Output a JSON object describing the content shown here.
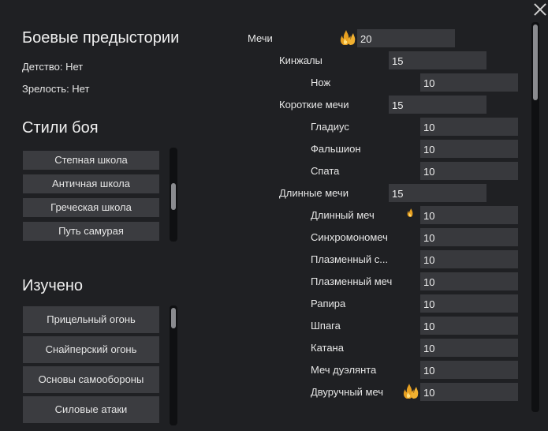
{
  "backgrounds": {
    "title": "Боевые предыстории",
    "childhood": "Детство: Нет",
    "maturity": "Зрелость: Нет"
  },
  "combat_styles": {
    "title": "Стили боя",
    "items": [
      "Степная школа",
      "Античная школа",
      "Греческая школа",
      "Путь самурая"
    ]
  },
  "learned": {
    "title": "Изучено",
    "items": [
      "Прицельный огонь",
      "Снайперский огонь",
      "Основы самообороны",
      "Силовые атаки"
    ]
  },
  "skills": {
    "swords": {
      "label": "Мечи",
      "value": "20",
      "passion": "major"
    },
    "daggers": {
      "label": "Кинжалы",
      "value": "15"
    },
    "knife": {
      "label": "Нож",
      "value": "10"
    },
    "short_swords": {
      "label": "Короткие мечи",
      "value": "15"
    },
    "gladius": {
      "label": "Гладиус",
      "value": "10"
    },
    "falchion": {
      "label": "Фальшион",
      "value": "10"
    },
    "spatha": {
      "label": "Спата",
      "value": "10"
    },
    "long_swords": {
      "label": "Длинные мечи",
      "value": "15"
    },
    "longsword": {
      "label": "Длинный меч",
      "value": "10",
      "passion": "minor"
    },
    "synchromonomech": {
      "label": "Синхромономеч",
      "value": "10"
    },
    "plasma_short": {
      "label": "Плазменный с...",
      "value": "10"
    },
    "plasma_sword": {
      "label": "Плазменный меч",
      "value": "10"
    },
    "rapier": {
      "label": "Рапира",
      "value": "10"
    },
    "shpaga": {
      "label": "Шпага",
      "value": "10"
    },
    "katana": {
      "label": "Катана",
      "value": "10"
    },
    "duelist_sword": {
      "label": "Меч дуэлянта",
      "value": "10"
    },
    "twohanded": {
      "label": "Двуручный меч",
      "value": "10",
      "passion": "major"
    }
  },
  "icons": {
    "close": "close-icon",
    "passion_major": "flame-icon",
    "passion_minor": "small-flame-icon"
  },
  "colors": {
    "background": "#1f2023",
    "button": "#3b3c40",
    "field": "#38393d",
    "flame": "#e8a020"
  }
}
